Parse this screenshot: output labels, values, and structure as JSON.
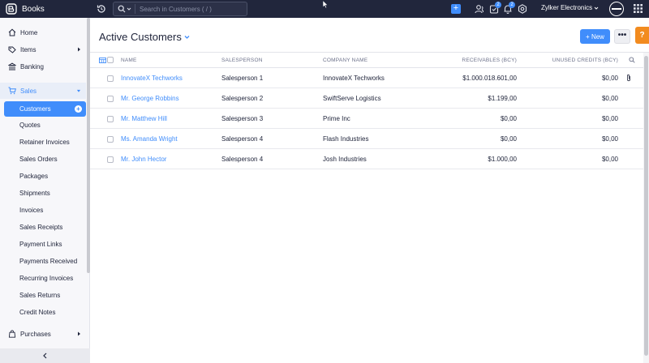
{
  "app": {
    "name": "Books"
  },
  "search": {
    "placeholder": "Search in Customers ( / )"
  },
  "topbar": {
    "org_name": "Zylker Electronics",
    "badge_tasks": "2",
    "badge_notifications": "2"
  },
  "sidebar": {
    "items": [
      {
        "label": "Home"
      },
      {
        "label": "Items"
      },
      {
        "label": "Banking"
      },
      {
        "label": "Sales"
      },
      {
        "label": "Purchases"
      }
    ],
    "sales_sub": [
      "Customers",
      "Quotes",
      "Retainer Invoices",
      "Sales Orders",
      "Packages",
      "Shipments",
      "Invoices",
      "Sales Receipts",
      "Payment Links",
      "Payments Received",
      "Recurring Invoices",
      "Sales Returns",
      "Credit Notes"
    ]
  },
  "main": {
    "title": "Active Customers",
    "new_label": "+ New",
    "more_label": "•••",
    "help_label": "?"
  },
  "table": {
    "headers": [
      "NAME",
      "SALESPERSON",
      "COMPANY NAME",
      "RECEIVABLES (BCY)",
      "UNUSED CREDITS (BCY)"
    ],
    "rows": [
      {
        "name": "InnovateX Techworks",
        "salesperson": "Salesperson 1",
        "company": "InnovateX Techworks",
        "receivables": "$1.000.018.601,00",
        "credits": "$0,00"
      },
      {
        "name": "Mr. George Robbins",
        "salesperson": "Salesperson 2",
        "company": "SwiftServe Logistics",
        "receivables": "$1.199,00",
        "credits": "$0,00"
      },
      {
        "name": "Mr. Matthew Hill",
        "salesperson": "Salesperson 3",
        "company": "Prime Inc",
        "receivables": "$0,00",
        "credits": "$0,00"
      },
      {
        "name": "Ms. Amanda Wright",
        "salesperson": "Salesperson 4",
        "company": "Flash Industries",
        "receivables": "$0,00",
        "credits": "$0,00"
      },
      {
        "name": "Mr. John Hector",
        "salesperson": "Salesperson 4",
        "company": "Josh Industries",
        "receivables": "$1.000,00",
        "credits": "$0,00"
      }
    ]
  },
  "colors": {
    "topbar": "#21263c",
    "accent": "#408dfb",
    "help": "#f28b1f"
  }
}
